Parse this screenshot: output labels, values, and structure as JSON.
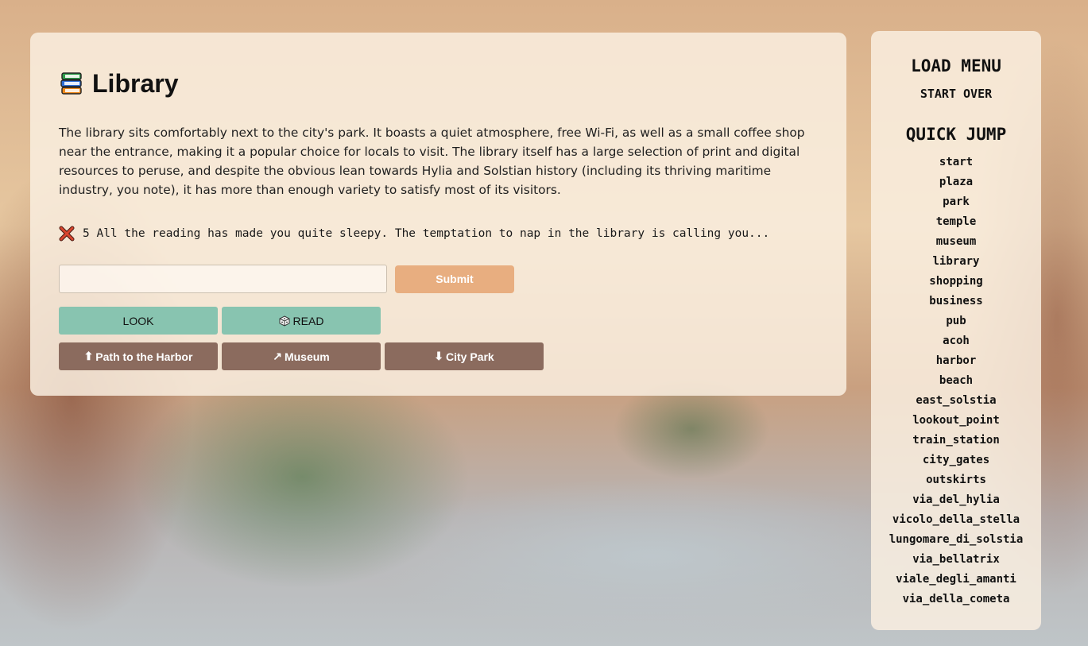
{
  "location": {
    "title": "Library",
    "title_icon": "books-icon",
    "description": "The library sits comfortably next to the city's park. It boasts a quiet atmosphere, free Wi-Fi, as well as a small coffee shop near the entrance, making it a popular choice for locals to visit. The library itself has a large selection of print and digital resources to peruse, and despite the obvious lean towards Hylia and Solstian history (including its thriving maritime industry, you note), it has more than enough variety to satisfy most of its visitors.",
    "status_icon": "red-x-icon",
    "status_text": "5 All the reading has made you quite sleepy. The temptation to nap in the library is calling you..."
  },
  "command": {
    "input_value": "",
    "submit_label": "Submit"
  },
  "actions": [
    {
      "label": "LOOK",
      "icon": ""
    },
    {
      "label": "READ",
      "icon": "die-icon"
    }
  ],
  "navigation": [
    {
      "arrow": "⬆",
      "label": "Path to the Harbor"
    },
    {
      "arrow": "↗",
      "label": "Museum"
    },
    {
      "arrow": "⬇",
      "label": "City Park"
    }
  ],
  "sidebar": {
    "load_menu": "LOAD MENU",
    "start_over": "START OVER",
    "quick_jump": "QUICK JUMP",
    "jumps": [
      "start",
      "plaza",
      "park",
      "temple",
      "museum",
      "library",
      "shopping",
      "business",
      "pub",
      "acoh",
      "harbor",
      "beach",
      "east_solstia",
      "lookout_point",
      "train_station",
      "city_gates",
      "outskirts",
      "via_del_hylia",
      "vicolo_della_stella",
      "lungomare_di_solstia",
      "via_bellatrix",
      "viale_degli_amanti",
      "via_della_cometa"
    ]
  },
  "colors": {
    "panel_bg": "#faf0e1",
    "submit": "#e8ae80",
    "action_button": "#88c4b0",
    "nav_button": "#8b6b5e"
  }
}
